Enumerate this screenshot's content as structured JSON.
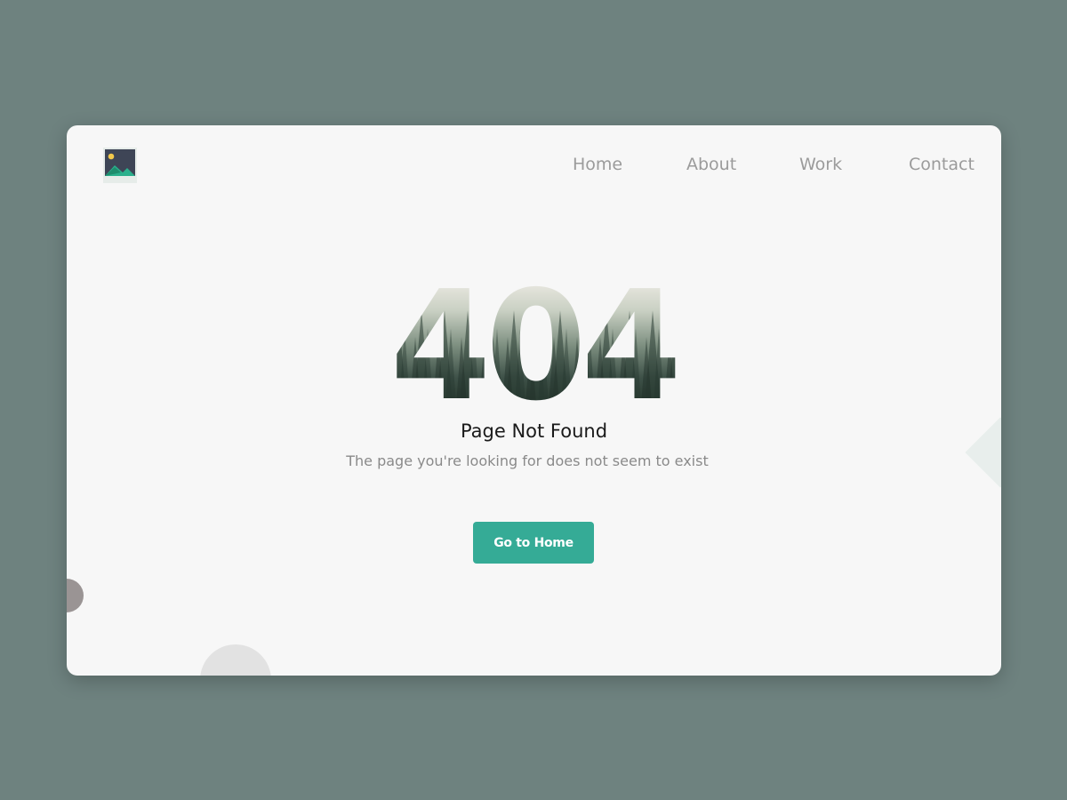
{
  "header": {
    "logo_icon": "image-placeholder-icon",
    "nav": [
      {
        "label": "Home"
      },
      {
        "label": "About"
      },
      {
        "label": "Work"
      },
      {
        "label": "Contact"
      }
    ]
  },
  "main": {
    "error_code": "404",
    "title": "Page Not Found",
    "subtitle": "The page you're looking for does not seem to exist",
    "cta_label": "Go to Home"
  },
  "colors": {
    "page_background": "#6e827f",
    "card_background": "#f7f7f7",
    "accent": "#35ab96",
    "nav_text": "#9b9b9b"
  }
}
